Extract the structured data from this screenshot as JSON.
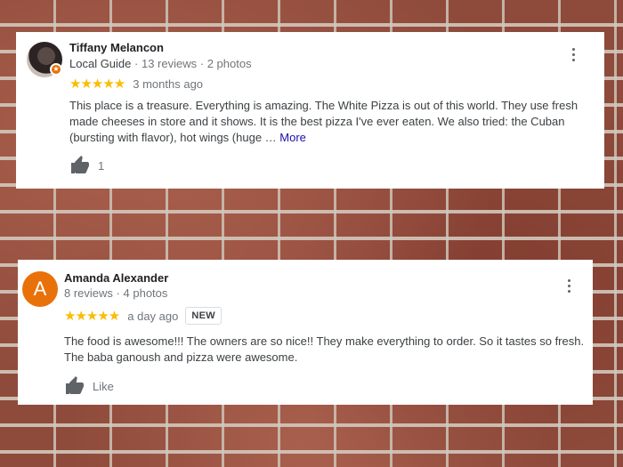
{
  "reviews": [
    {
      "author": "Tiffany Melancon",
      "guide_label": "Local Guide",
      "separator": "·",
      "reviews_count": "13 reviews",
      "photos_count": "2 photos",
      "stars": "★★★★★",
      "time": "3 months ago",
      "text": "This place is a treasure. Everything is amazing. The White Pizza is out of this world. They use fresh made cheeses in store and it shows. It is the best pizza I've ever eaten. We also tried: the Cuban (bursting with flavor), hot wings (huge …",
      "more_label": "More",
      "like_count": "1",
      "avatar_icon": "profile-photo",
      "badge_icon": "local-guide-star-icon"
    },
    {
      "author": "Amanda Alexander",
      "avatar_letter": "A",
      "separator": "·",
      "reviews_count": "8 reviews",
      "photos_count": "4 photos",
      "stars": "★★★★★",
      "time": "a day ago",
      "new_badge": "NEW",
      "text": "The food is awesome!!! The owners are so nice!! They make everything to order. So it tastes so fresh. The baba ganoush and pizza were awesome.",
      "like_label": "Like"
    }
  ],
  "colors": {
    "star": "#fbbc04",
    "avatar_orange": "#e8710a",
    "link": "#1a0dab"
  }
}
